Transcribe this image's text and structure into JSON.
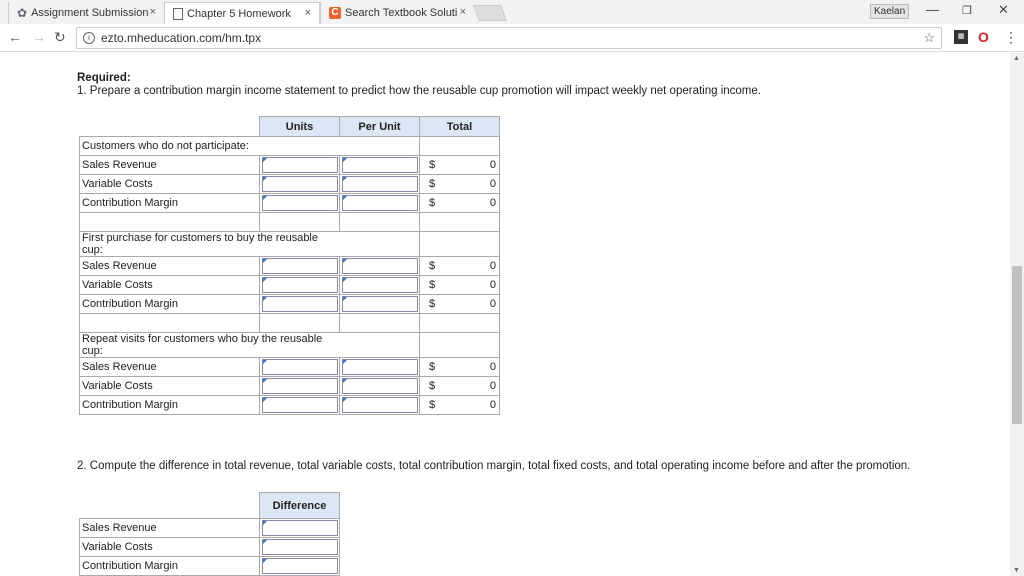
{
  "browser": {
    "tabs": [
      {
        "title": "Assignment Submission",
        "icon": "gear-icon"
      },
      {
        "title": "Chapter 5 Homework",
        "icon": "document-icon"
      },
      {
        "title": "Search Textbook Solution",
        "icon": "chegg-c-icon"
      }
    ],
    "user_badge": "Kaelan",
    "url": "ezto.mheducation.com/hm.tpx"
  },
  "page": {
    "required_label": "Required:",
    "question1": "1. Prepare a contribution margin income statement to predict how the reusable cup promotion will impact weekly net operating income.",
    "question2": "2. Compute the difference in total revenue, total variable costs, total contribution margin, total fixed costs, and total operating income before and after the promotion."
  },
  "table1": {
    "headers": {
      "units": "Units",
      "per_unit": "Per Unit",
      "total": "Total"
    },
    "dollar": "$",
    "sections": [
      {
        "title": "Customers who do not participate:",
        "rows": [
          {
            "label": "Sales Revenue",
            "total": "0"
          },
          {
            "label": "Variable Costs",
            "total": "0"
          },
          {
            "label": "Contribution Margin",
            "total": "0"
          }
        ]
      },
      {
        "title": "First purchase for customers to buy the reusable cup:",
        "rows": [
          {
            "label": "Sales Revenue",
            "total": "0"
          },
          {
            "label": "Variable Costs",
            "total": "0"
          },
          {
            "label": "Contribution Margin",
            "total": "0"
          }
        ]
      },
      {
        "title": "Repeat visits for customers who buy the reusable cup:",
        "rows": [
          {
            "label": "Sales Revenue",
            "total": "0"
          },
          {
            "label": "Variable Costs",
            "total": "0"
          },
          {
            "label": "Contribution Margin",
            "total": "0"
          }
        ]
      }
    ]
  },
  "table2": {
    "header": "Difference",
    "rows": [
      "Sales Revenue",
      "Variable Costs",
      "Contribution Margin"
    ]
  }
}
